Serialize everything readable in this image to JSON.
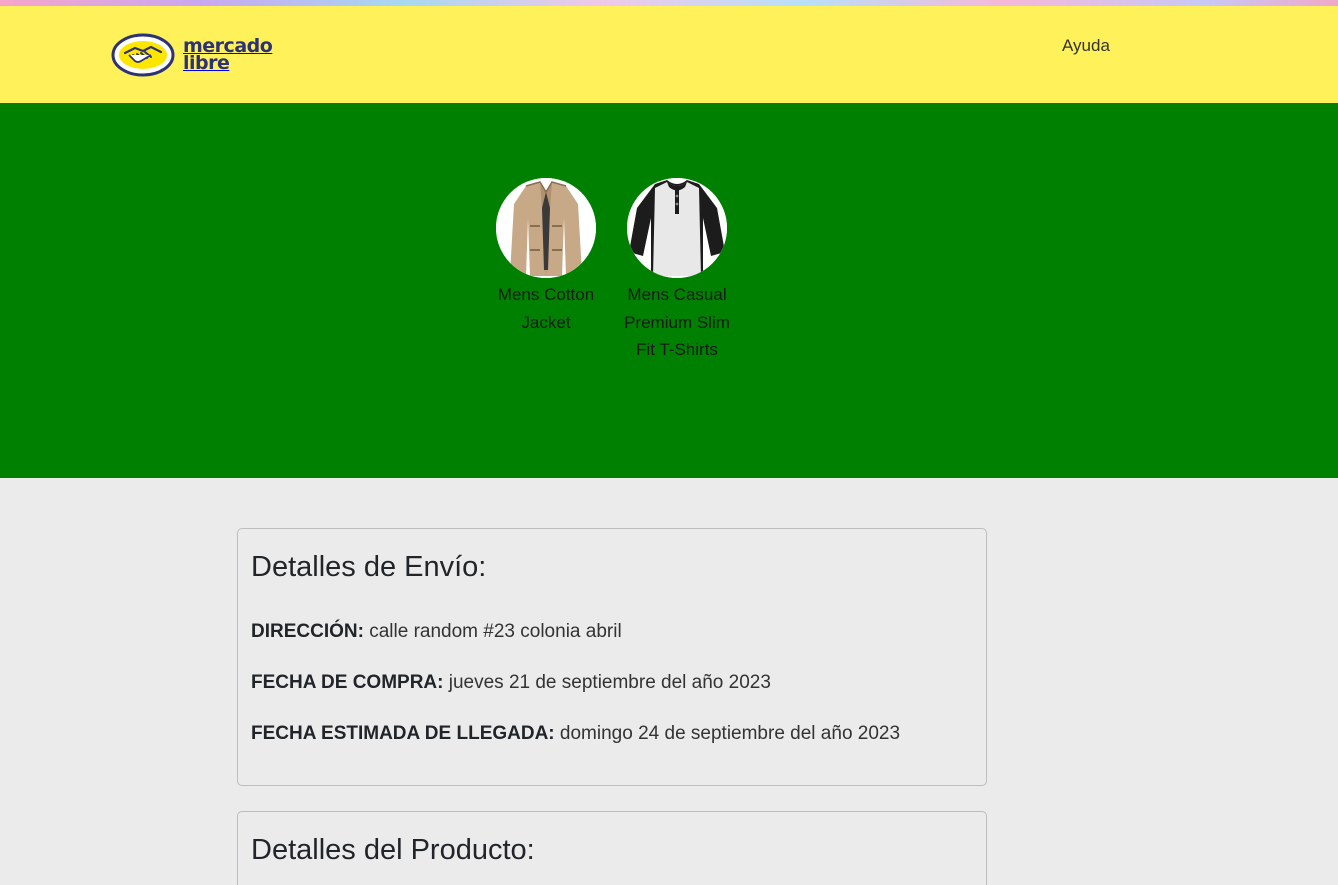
{
  "header": {
    "brand_line1": "mercado",
    "brand_line2": "libre",
    "help_label": "Ayuda",
    "background": "#fff159"
  },
  "hero": {
    "background": "#008000",
    "products": [
      {
        "name": "Mens Cotton Jacket",
        "icon": "jacket-image"
      },
      {
        "name": "Mens Casual Premium Slim Fit T-Shirts",
        "icon": "tshirt-image"
      }
    ]
  },
  "shipping": {
    "title": "Detalles de Envío:",
    "address_label": "DIRECCIÓN:",
    "address_value": "calle random #23 colonia abril",
    "purchase_date_label": "FECHA DE COMPRA:",
    "purchase_date_value": "jueves 21 de septiembre del año 2023",
    "arrival_label": "FECHA ESTIMADA DE LLEGADA:",
    "arrival_value": "domingo 24 de septiembre del año 2023"
  },
  "product_details": {
    "title": "Detalles del Producto:"
  }
}
